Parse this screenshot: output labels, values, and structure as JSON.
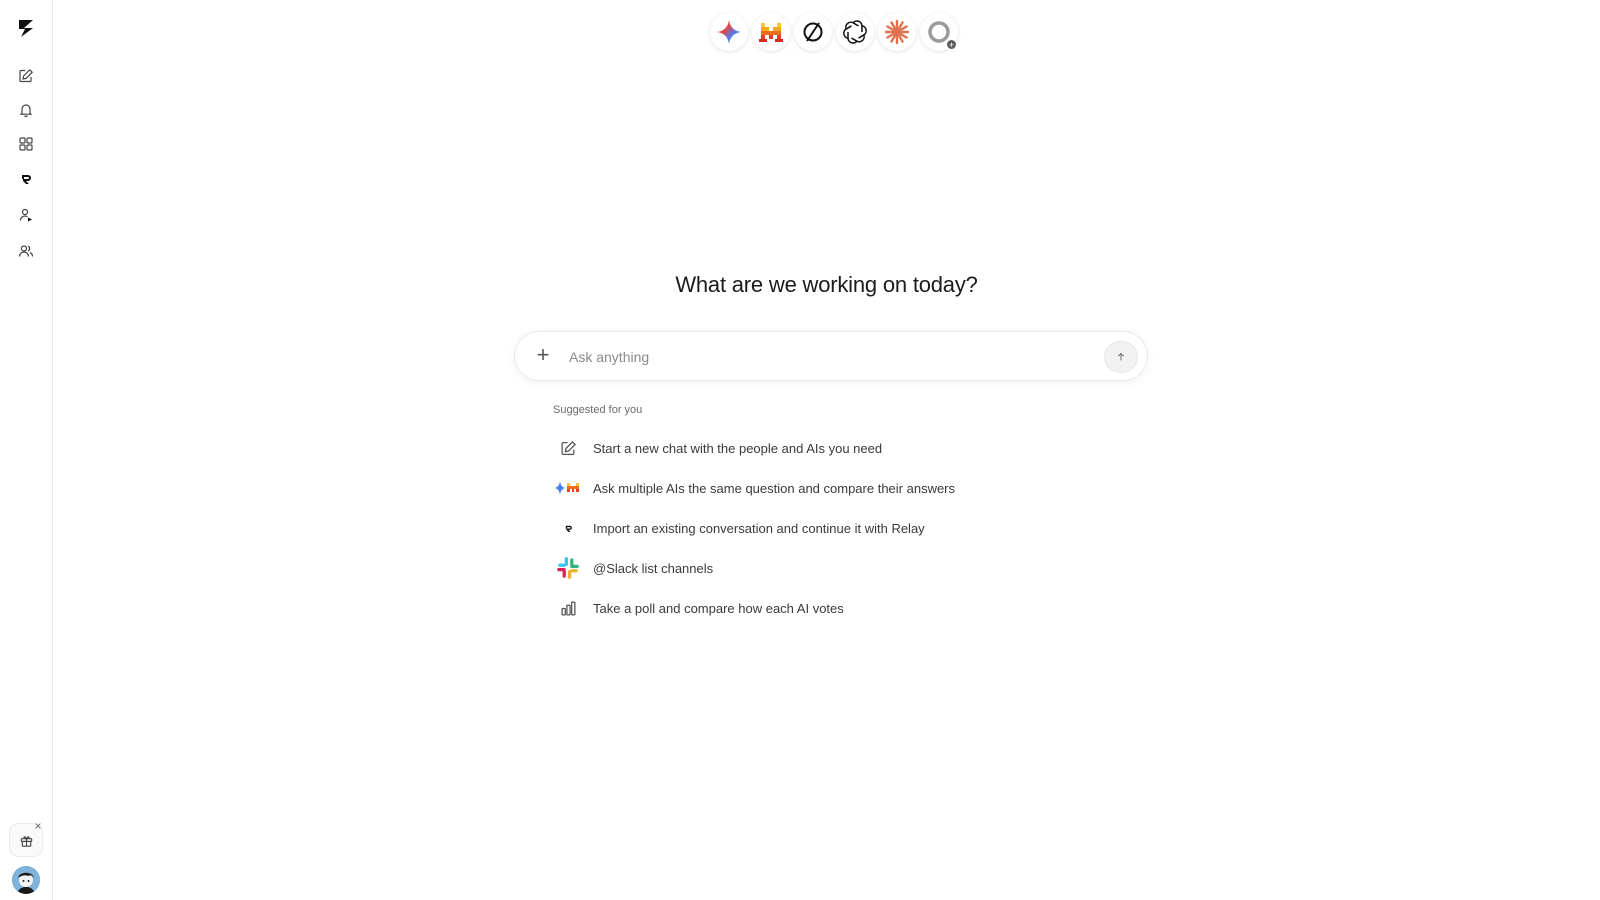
{
  "sidebar": {
    "logo": "relay-logo-icon",
    "items": [
      {
        "name": "new-chat",
        "icon": "compose-icon"
      },
      {
        "name": "notifications",
        "icon": "bell-icon"
      },
      {
        "name": "apps",
        "icon": "grid-icon"
      },
      {
        "name": "relay",
        "icon": "relay-icon"
      },
      {
        "name": "agents",
        "icon": "person-arrow-icon"
      },
      {
        "name": "contacts",
        "icon": "people-icon"
      }
    ],
    "gift_icon": "gift-icon",
    "gift_close": "×"
  },
  "models": [
    {
      "name": "gemini",
      "icon": "gemini-icon"
    },
    {
      "name": "mistral",
      "icon": "mistral-icon"
    },
    {
      "name": "perplexity",
      "icon": "perplexity-icon"
    },
    {
      "name": "openai",
      "icon": "openai-icon"
    },
    {
      "name": "claude",
      "icon": "claude-icon"
    },
    {
      "name": "more-models",
      "icon": "circle-plus-icon",
      "badge": "+"
    }
  ],
  "main": {
    "headline": "What are we working on today?",
    "composer": {
      "add_label": "+",
      "placeholder": "Ask anything",
      "value": ""
    },
    "suggested_title": "Suggested for you",
    "suggestions": [
      {
        "icon": "compose-icon",
        "text": "Start a new chat with the people and AIs you need"
      },
      {
        "icon": "multi-ai-icon",
        "text": "Ask multiple AIs the same question and compare their answers"
      },
      {
        "icon": "relay-icon",
        "text": "Import an existing conversation and continue it with Relay"
      },
      {
        "icon": "slack-icon",
        "text": "@Slack list channels"
      },
      {
        "icon": "bar-chart-icon",
        "text": "Take a poll and compare how each AI votes"
      }
    ]
  },
  "colors": {
    "accent_claude": "#e0714f",
    "mistral_orange": "#f26b1d",
    "gemini_blue": "#4a7ff5"
  }
}
